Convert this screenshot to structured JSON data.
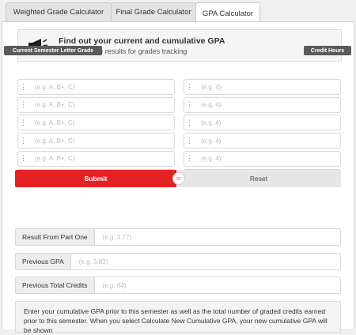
{
  "tabs": [
    {
      "label": "Weighted Grade Calculator",
      "active": false
    },
    {
      "label": "Final Grade Calculator",
      "active": false
    },
    {
      "label": "GPA Calculator",
      "active": true
    }
  ],
  "header": {
    "icon": "megaphone-icon",
    "title": "Find out your current and cumulative GPA",
    "subtitle": "You may save results for grades tracking"
  },
  "columns": {
    "grade_label": "Current Semester Letter Grade",
    "credit_label": "Credit Hours"
  },
  "rows": [
    {
      "grade_placeholder": "(e.g. A, B+, C)",
      "credit_placeholder": "(e.g. 4)"
    },
    {
      "grade_placeholder": "(e.g. A, B+, C)",
      "credit_placeholder": "(e.g. 4)"
    },
    {
      "grade_placeholder": "(e.g. A, B+, C)",
      "credit_placeholder": "(e.g. 4)"
    },
    {
      "grade_placeholder": "(e.g. A, B+, C)",
      "credit_placeholder": "(e.g. 4)"
    },
    {
      "grade_placeholder": "(e.g. A, B+, C)",
      "credit_placeholder": "(e.g. 4)"
    },
    {
      "grade_placeholder": "(e.g. A, B+, C)",
      "credit_placeholder": "(e.g. 4)"
    }
  ],
  "buttons": {
    "submit": "Submit",
    "or": "or",
    "reset": "Reset"
  },
  "cumulative": [
    {
      "label": "Result From Part One",
      "placeholder": "(e.g. 3.77)"
    },
    {
      "label": "Previous GPA",
      "placeholder": "(e.g. 3.83)"
    },
    {
      "label": "Previous Total Credits",
      "placeholder": "(e.g. 84)"
    }
  ],
  "info_text": "Enter your cumulative GPA prior to this semester as well as the total number of graded credits earned prior to this semester. When you select Calculate New Cumulative GPA, your new cumulative GPA will be shown",
  "colors": {
    "accent": "#e62323",
    "label_bg": "#5a5a5a"
  }
}
